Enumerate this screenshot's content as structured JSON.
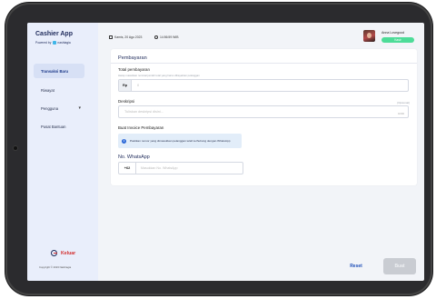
{
  "sidebar": {
    "app_title": "Cashier App",
    "powered_by": "Powered by",
    "brand": "nashtagia",
    "items": [
      {
        "label": "Transaksi Baru",
        "active": true
      },
      {
        "label": "Riwayat",
        "active": false
      },
      {
        "label": "Pengguna",
        "active": false,
        "has_dropdown": true
      },
      {
        "label": "Pusat Bantuan",
        "active": false
      }
    ],
    "logout_label": "Keluar",
    "copyright": "Copyright © 2023 Nashtagia"
  },
  "topbar": {
    "date": "Kamis, 20 Agu 2023",
    "time": "14:56:59 WIB",
    "user_name": "Anna Lovegood",
    "role": "Kasir"
  },
  "form": {
    "title": "Pembayaran",
    "total_label": "Total pembayaran",
    "total_hint": "Harap masukkan nominal jumlah total yang harus dibayarkan pelanggan",
    "currency_prefix": "Rp",
    "amount_value": "0",
    "desc_label": "Deskripsi",
    "desc_optional": "(Opsional)",
    "desc_placeholder": "Tuliskan deskripsi disini...",
    "desc_counter": "0/200",
    "invoice_label": "Buat Invoice Pembayaran",
    "info_text": "Pastikan nomor yang dimasukkan pelanggan telah terhubung dengan WhatsApp",
    "wa_label": "No. WhatsApp",
    "wa_prefix": "+62",
    "wa_placeholder": "Masukkan No. WhatsApp"
  },
  "actions": {
    "reset_label": "Reset",
    "submit_label": "Buat"
  },
  "colors": {
    "accent": "#1e3a8a",
    "sidebar_bg": "#e9eefb",
    "badge": "#4ddc98",
    "danger": "#d32f2f",
    "disabled": "#c9ccd2"
  },
  "icons": [
    "calendar-icon",
    "clock-icon",
    "chevron-down-icon",
    "info-icon",
    "logout-icon"
  ]
}
